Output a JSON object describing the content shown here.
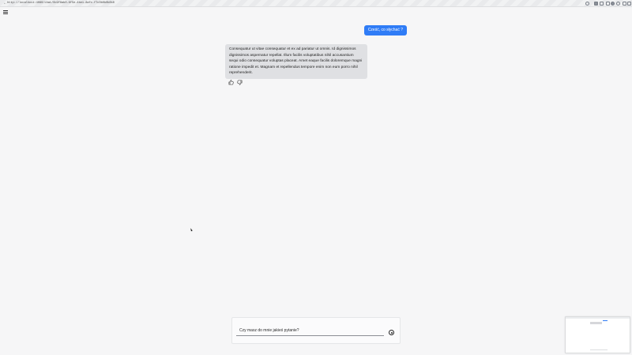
{
  "browser": {
    "back_glyph": "←",
    "url": "http://localhost:4080/chat/0c9f8ab0-6f5e-4be1-8afc-f7c0b0b0b0b0"
  },
  "chat": {
    "user_message": "Cześć, co słychać ?",
    "bot_message": "Consequatur ut vitae consequatur et ex ad pariatur ut omnis. Id dignissimos dignissimos aspernatur repellat. Illum facilis voluptatibus nihil accusantium sequi odio consequatur voluptas placeat. Amet eaque facilis doloremque magni ratione impedit et. Magnam et repellendus tempore enim non eum porro nihil reprehenderit."
  },
  "composer": {
    "placeholder": "Czy masz do mnie jakieś pytanie?"
  },
  "colors": {
    "accent": "#2f7cf6",
    "bot_bubble": "#dfe0e3",
    "background": "#f6f6f7"
  },
  "icons": {
    "menu": "hamburger-icon",
    "like": "thumbs-up-icon",
    "dislike": "thumbs-down-icon",
    "send": "send-icon"
  }
}
